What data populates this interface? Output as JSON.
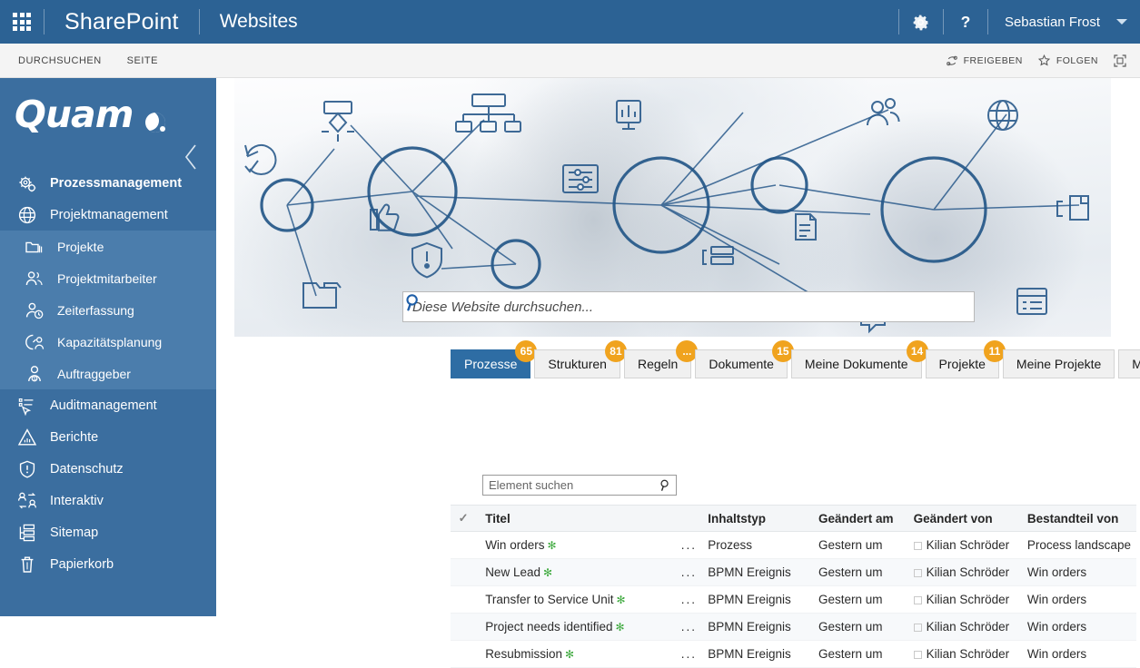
{
  "suite": {
    "waffle_icon": "waffle-icon",
    "brand": "SharePoint",
    "site": "Websites",
    "settings_icon": "gear-icon",
    "help_icon": "help-icon",
    "user_name": "Sebastian Frost",
    "user_caret_icon": "chevron-down-icon"
  },
  "ribbon": {
    "tabs": [
      "DURCHSUCHEN",
      "SEITE"
    ],
    "share_label": "FREIGEBEN",
    "share_icon": "share-icon",
    "follow_label": "FOLGEN",
    "follow_icon": "star-icon",
    "focus_icon": "focus-on-content-icon"
  },
  "sidebar": {
    "logo": "Quam",
    "collapse_icon": "chevron-left-icon",
    "items": [
      {
        "label": "Prozessmanagement",
        "icon": "gears-icon",
        "level": "top",
        "bold": true,
        "active": false
      },
      {
        "label": "Projektmanagement",
        "icon": "globe-icon",
        "level": "top",
        "bold": false,
        "active": true
      },
      {
        "label": "Projekte",
        "icon": "folders-icon",
        "level": "sub",
        "active": true
      },
      {
        "label": "Projektmitarbeiter",
        "icon": "people-icon",
        "level": "sub",
        "active": false
      },
      {
        "label": "Zeiterfassung",
        "icon": "person-clock-icon",
        "level": "sub",
        "active": false
      },
      {
        "label": "Kapazitätsplanung",
        "icon": "gauge-person-icon",
        "level": "sub",
        "active": false
      },
      {
        "label": "Auftraggeber",
        "icon": "person-money-icon",
        "level": "sub",
        "active": false
      },
      {
        "label": "Auditmanagement",
        "icon": "checklist-cursor-icon",
        "level": "top",
        "bold": false,
        "active": false
      },
      {
        "label": "Berichte",
        "icon": "chart-report-icon",
        "level": "top",
        "bold": false,
        "active": false
      },
      {
        "label": "Datenschutz",
        "icon": "shield-alert-icon",
        "level": "top",
        "bold": false,
        "active": false
      },
      {
        "label": "Interaktiv",
        "icon": "people-exchange-icon",
        "level": "top",
        "bold": false,
        "active": false
      },
      {
        "label": "Sitemap",
        "icon": "sitemap-icon",
        "level": "top",
        "bold": false,
        "active": false
      },
      {
        "label": "Papierkorb",
        "icon": "trash-icon",
        "level": "top",
        "bold": false,
        "active": false
      }
    ]
  },
  "hero": {
    "search_placeholder": "Diese Website durchsuchen...",
    "search_value": "",
    "search_icon": "search-icon"
  },
  "tabs": [
    {
      "label": "Prozesse",
      "badge": "65",
      "active": true
    },
    {
      "label": "Strukturen",
      "badge": "81",
      "active": false
    },
    {
      "label": "Regeln",
      "badge": "...",
      "active": false
    },
    {
      "label": "Dokumente",
      "badge": "15",
      "active": false
    },
    {
      "label": "Meine Dokumente",
      "badge": "14",
      "active": false
    },
    {
      "label": "Projekte",
      "badge": "11",
      "active": false
    },
    {
      "label": "Meine Projekte",
      "badge": null,
      "active": false
    },
    {
      "label": "Meine Audits",
      "badge": null,
      "active": false
    }
  ],
  "item_search": {
    "placeholder": "Element suchen",
    "value": "",
    "icon": "search-icon"
  },
  "list": {
    "select_all_icon": "checkmark-icon",
    "columns": [
      "Titel",
      "Inhaltstyp",
      "Geändert am",
      "Geändert von",
      "Bestandteil von"
    ],
    "ellipsis": "...",
    "new_marker": "✻",
    "rows": [
      {
        "title": "Win orders",
        "new": true,
        "type": "Prozess",
        "modified": "Gestern um",
        "modified_by": "Kilian Schröder",
        "part_of": "Process landscape"
      },
      {
        "title": "New Lead",
        "new": true,
        "type": "BPMN Ereignis",
        "modified": "Gestern um",
        "modified_by": "Kilian Schröder",
        "part_of": "Win orders"
      },
      {
        "title": "Transfer to Service Unit",
        "new": true,
        "type": "BPMN Ereignis",
        "modified": "Gestern um",
        "modified_by": "Kilian Schröder",
        "part_of": "Win orders"
      },
      {
        "title": "Project needs identified",
        "new": true,
        "type": "BPMN Ereignis",
        "modified": "Gestern um",
        "modified_by": "Kilian Schröder",
        "part_of": "Win orders"
      },
      {
        "title": "Resubmission",
        "new": true,
        "type": "BPMN Ereignis",
        "modified": "Gestern um",
        "modified_by": "Kilian Schröder",
        "part_of": "Win orders"
      }
    ]
  },
  "colors": {
    "suitebar": "#2c6294",
    "sidebar": "#3b6e9f",
    "sidebar_active": "#4b7dac",
    "tab_active": "#2e6da4",
    "badge": "#f0a31e",
    "new_marker": "#3faa3f"
  }
}
